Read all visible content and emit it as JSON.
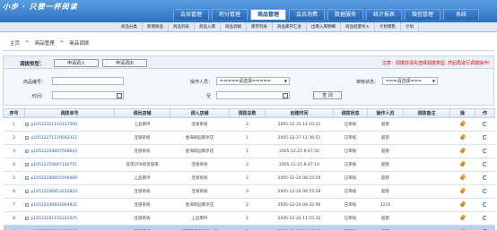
{
  "header": {
    "logo": "小步 · 只要一杯阅读",
    "nav": [
      {
        "label": "会员管理"
      },
      {
        "label": "积分管理"
      },
      {
        "label": "商品管理"
      },
      {
        "label": "会员消费"
      },
      {
        "label": "数据服务"
      },
      {
        "label": "统计报表"
      },
      {
        "label": "微信管理"
      },
      {
        "label": "系统"
      }
    ],
    "active_index": 2,
    "sub_nav": [
      "商品分类",
      "新增商品",
      "商品列表",
      "商品入库",
      "商品调拨",
      "库存列表",
      "商品库存汇总",
      "出库入库明细",
      "商品批量导入",
      "计划销售",
      "计划"
    ]
  },
  "breadcrumb": [
    "主页",
    "商品管理",
    "商品调拨"
  ],
  "filter": {
    "type_label": "调拨类型：",
    "type_buttons": [
      "申请调入",
      "申请调出"
    ],
    "notice": "注意：调拨前请先选择调拨类型, 然后再进行调拨操作!",
    "goods_label": "商品编号：",
    "operator_label": "操作人员：",
    "operator_value": "=====请选择=====",
    "audit_label": "审核状态：",
    "audit_value": "===请选择===",
    "time_label": "时间：",
    "to_label": "至",
    "query_button": "查 询"
  },
  "table": {
    "columns": [
      "序号",
      "调拨单号",
      "调出店铺",
      "调入店铺",
      "调拨总数",
      "创建时间",
      "调拨状态",
      "操作人员",
      "调拨备注",
      "操",
      "作"
    ],
    "rows": [
      {
        "no": "1",
        "order": "p10512311110317500",
        "out": "上品南坪",
        "in": "连锁系统",
        "qty": "2",
        "time": "2005-12-31 11:10:21",
        "status": "已审核",
        "op": "超管",
        "out_red": true
      },
      {
        "no": "2",
        "order": "p10512271119592312",
        "out": "连锁系统",
        "in": "金海新园南亭店",
        "qty": "1",
        "time": "2005-12-27 11:36:51",
        "status": "已审核",
        "op": "超管",
        "out_red": true
      },
      {
        "no": "3",
        "order": "p10512250847568643",
        "out": "连锁系统",
        "in": "金海新园南亭店",
        "qty": "1",
        "time": "2005-12-25 8:47:56",
        "status": "已审核",
        "op": "超管",
        "out_red": true
      },
      {
        "no": "4",
        "order": "p10512250847140751",
        "out": "莲花DTN商贸盘来",
        "in": "连锁系统",
        "qty": "2",
        "time": "2005-12-25 8:47:14",
        "status": "已审核",
        "op": "超管",
        "out_red": true
      },
      {
        "no": "5",
        "order": "p10512240855590468",
        "out": "上品南坪",
        "in": "连锁系统",
        "qty": "2",
        "time": "2005-12-24 08:55:59",
        "status": "已审核",
        "op": "超管",
        "out_red": true
      },
      {
        "no": "6",
        "order": "p10512240853232823",
        "out": "连锁系统",
        "in": "连锁系统",
        "qty": "3",
        "time": "2005-12-24 08:53:28",
        "status": "已审核",
        "op": "超管",
        "out_red": true
      },
      {
        "no": "7",
        "order": "p10512240832064932",
        "out": "连锁系统",
        "in": "金海新园南亭店",
        "qty": "2",
        "time": "2005-12-24 08:32:06",
        "status": "已审核",
        "op": "3210",
        "out_red": true
      },
      {
        "no": "8",
        "order": "p10512241155321025",
        "out": "连锁系统",
        "in": "上品南坪",
        "qty": "1",
        "time": "2005-12-24 11:55:32",
        "status": "已审核",
        "op": "超管",
        "out_red": true
      },
      {
        "no": "9",
        "order": "p10512160240008807",
        "out": "连锁系统",
        "in": "华钢百货户372—国",
        "qty": "2",
        "time": "2005-12-16 12:40:02",
        "status": "已审核",
        "op": "超管",
        "out_red": true
      }
    ],
    "selected_row": 8
  },
  "icons": {
    "edit": "pencil-icon",
    "refresh": "refresh-icon",
    "expand": "plus-box-icon",
    "calendar": "calendar-icon"
  }
}
